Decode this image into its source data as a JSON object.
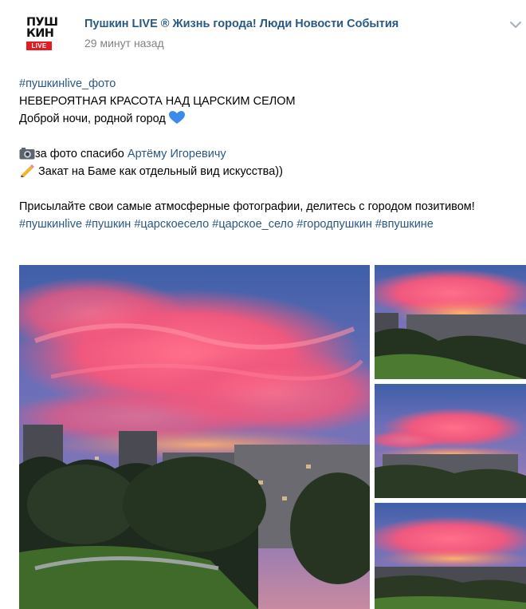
{
  "post": {
    "group_name": "Пушкин LIVE ® Жизнь города! Люди Новости События",
    "time": "29 минут назад",
    "avatar": {
      "line1": "ПУШ",
      "line2": "КИН",
      "badge": "LIVE"
    },
    "tag_line": "#пушкинlive_фото",
    "headline": "НЕВЕРОЯТНАЯ КРАСОТА НАД ЦАРСКИМ СЕЛОМ",
    "goodnight": "Доброй ночи, родной город",
    "photo_thanks": "за фото спасибо ",
    "photographer": "Артёму Игоревичу",
    "caption": " Закат на Баме как отдельный вид искусства))",
    "invite": "Присылайте свои самые атмосферные фотографии, делитесь с городом позитивом!",
    "hashtags": [
      "#пушкинlive",
      "#пушкин",
      "#царскоесело",
      "#царское_село",
      "#городпушкин",
      "#впушкине"
    ]
  },
  "icons": {
    "chevron": "chevron-down-icon",
    "heart": "blue-heart-icon",
    "camera": "camera-icon",
    "pencil": "pencil-icon"
  },
  "colors": {
    "link": "#2a5885",
    "badge": "#e31b23",
    "muted": "#828282"
  }
}
